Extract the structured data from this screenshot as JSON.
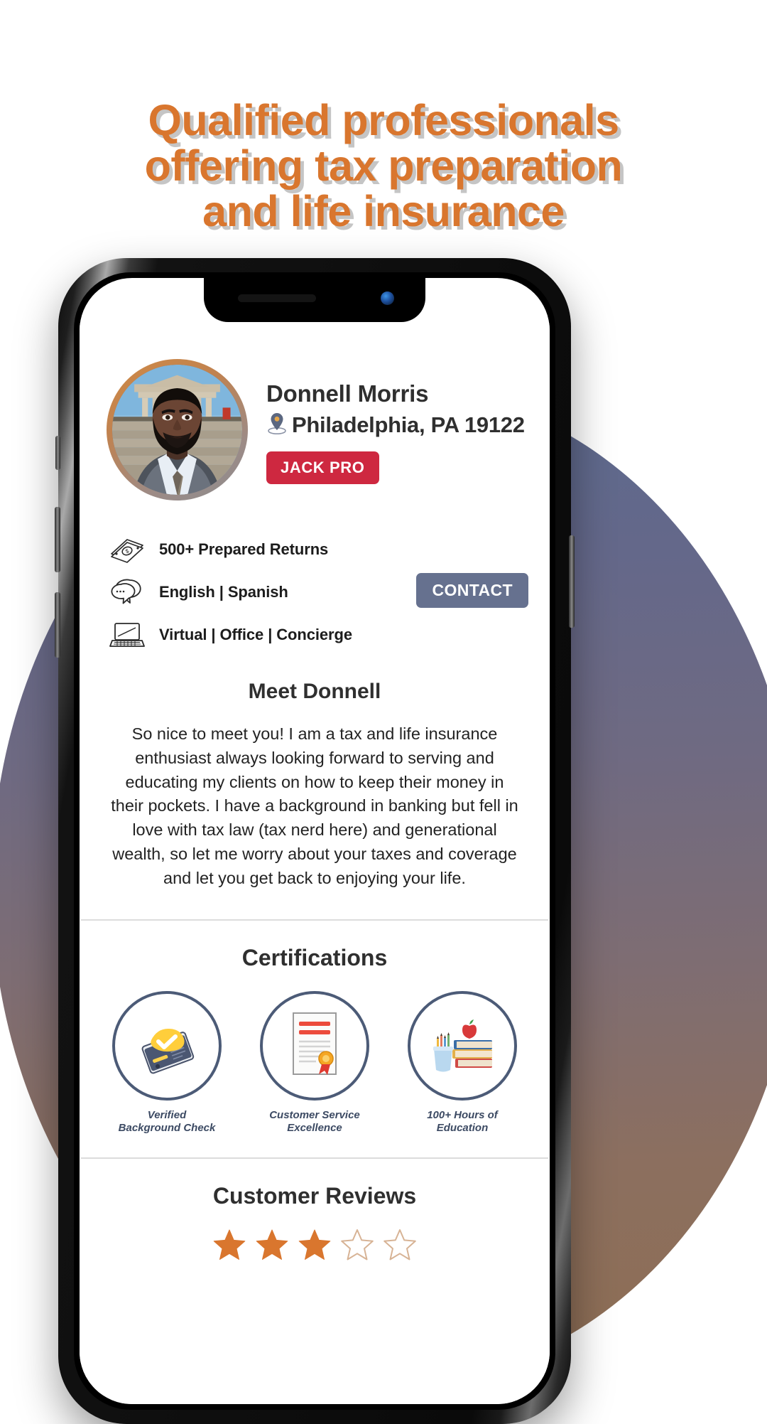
{
  "headline": {
    "lines": [
      "Qualified professionals",
      "offering tax preparation",
      "and life insurance"
    ],
    "color": "#d9762e",
    "shadow_color": "#969696"
  },
  "background": {
    "page_color": "#ffffff",
    "circle_gradient_top": "#5c6a8e",
    "circle_gradient_bottom": "#8e6e53"
  },
  "phone": {
    "frame_color": "#0b0b0b",
    "notch": {
      "speaker_icon": "speaker-slot-icon",
      "camera_icon": "front-camera-icon"
    },
    "buttons": {
      "mute": "mute-switch",
      "volume_up": "volume-up-button",
      "volume_down": "volume-down-button",
      "power": "power-button"
    }
  },
  "profile": {
    "avatar_icon": "profile-photo",
    "avatar_ring_from": "#d08a45",
    "avatar_ring_to": "#8c8c8f",
    "name": "Donnell Morris",
    "location_icon": "map-pin-icon",
    "location": "Philadelphia, PA 19122",
    "badge_label": "JACK PRO",
    "badge_color": "#ce2840"
  },
  "stats": {
    "rows": [
      {
        "icon": "money-stack-icon",
        "label": "500+ Prepared Returns"
      },
      {
        "icon": "speech-bubbles-icon",
        "label": "English | Spanish"
      },
      {
        "icon": "laptop-icon",
        "label": "Virtual | Office | Concierge"
      }
    ],
    "contact_label": "CONTACT",
    "contact_color": "#66718f"
  },
  "bio": {
    "title": "Meet Donnell",
    "text": "So nice to meet you! I am a tax and life insurance enthusiast always looking forward to serving and educating my clients on how to keep their money in their pockets. I have a background in banking but fell in love with tax law (tax nerd here) and generational wealth, so let me worry about your taxes and coverage and let you get back to enjoying your life."
  },
  "certifications": {
    "title": "Certifications",
    "items": [
      {
        "icon": "id-card-check-icon",
        "label": "Verified\nBackground Check"
      },
      {
        "icon": "certificate-ribbon-icon",
        "label": "Customer Service\nExcellence"
      },
      {
        "icon": "books-apple-icon",
        "label": "100+ Hours of\nEducation"
      }
    ],
    "ring_color": "#4c5b77"
  },
  "reviews": {
    "title": "Customer Reviews",
    "rating": 3,
    "max_rating": 5,
    "star_color": "#d9762e",
    "star_empty_color": "#d7b395"
  }
}
